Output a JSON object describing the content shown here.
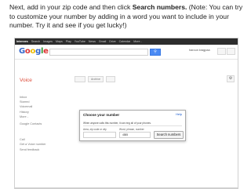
{
  "instruction": {
    "part1": "Next, add in your zip code and then click ",
    "bold": "Search numbers.",
    "part2": " (Note:  You can try to customize your number by adding in a word you want to include in your number.  Try it and see if you get lucky!)"
  },
  "topbar": {
    "items": [
      "Intennes",
      "Search",
      "Images",
      "Maps",
      "Play",
      "YouTube",
      "News",
      "Gmail",
      "Drive",
      "Calendar",
      "More -"
    ]
  },
  "header": {
    "logo": "Google",
    "search_button": "⚲",
    "user_name": "haroun kragpaa"
  },
  "page": {
    "title": "Voice",
    "toolbar": [
      "",
      "",
      "Archive"
    ],
    "settings_icon": "⚙"
  },
  "sidebar": {
    "items": [
      "Inbox",
      "Starred",
      "Voicemail",
      "History",
      "More -"
    ],
    "contacts": "Google Contacts",
    "call": "Call",
    "links": [
      "Get a Voice number",
      "Send feedback"
    ]
  },
  "dialog": {
    "title": "Choose your number",
    "help": "Help",
    "subtitle": "When anyone calls this number, it can ring all of your phones.",
    "label_zip": "Area, zip code or city",
    "label_word": "Word, phrase, number",
    "field_value": "4585",
    "search_button": "Search numbers"
  },
  "colors": {
    "topbar": "#2d2d2d",
    "accent_red": "#dd4b39",
    "blue_button": "#4a8af4"
  }
}
